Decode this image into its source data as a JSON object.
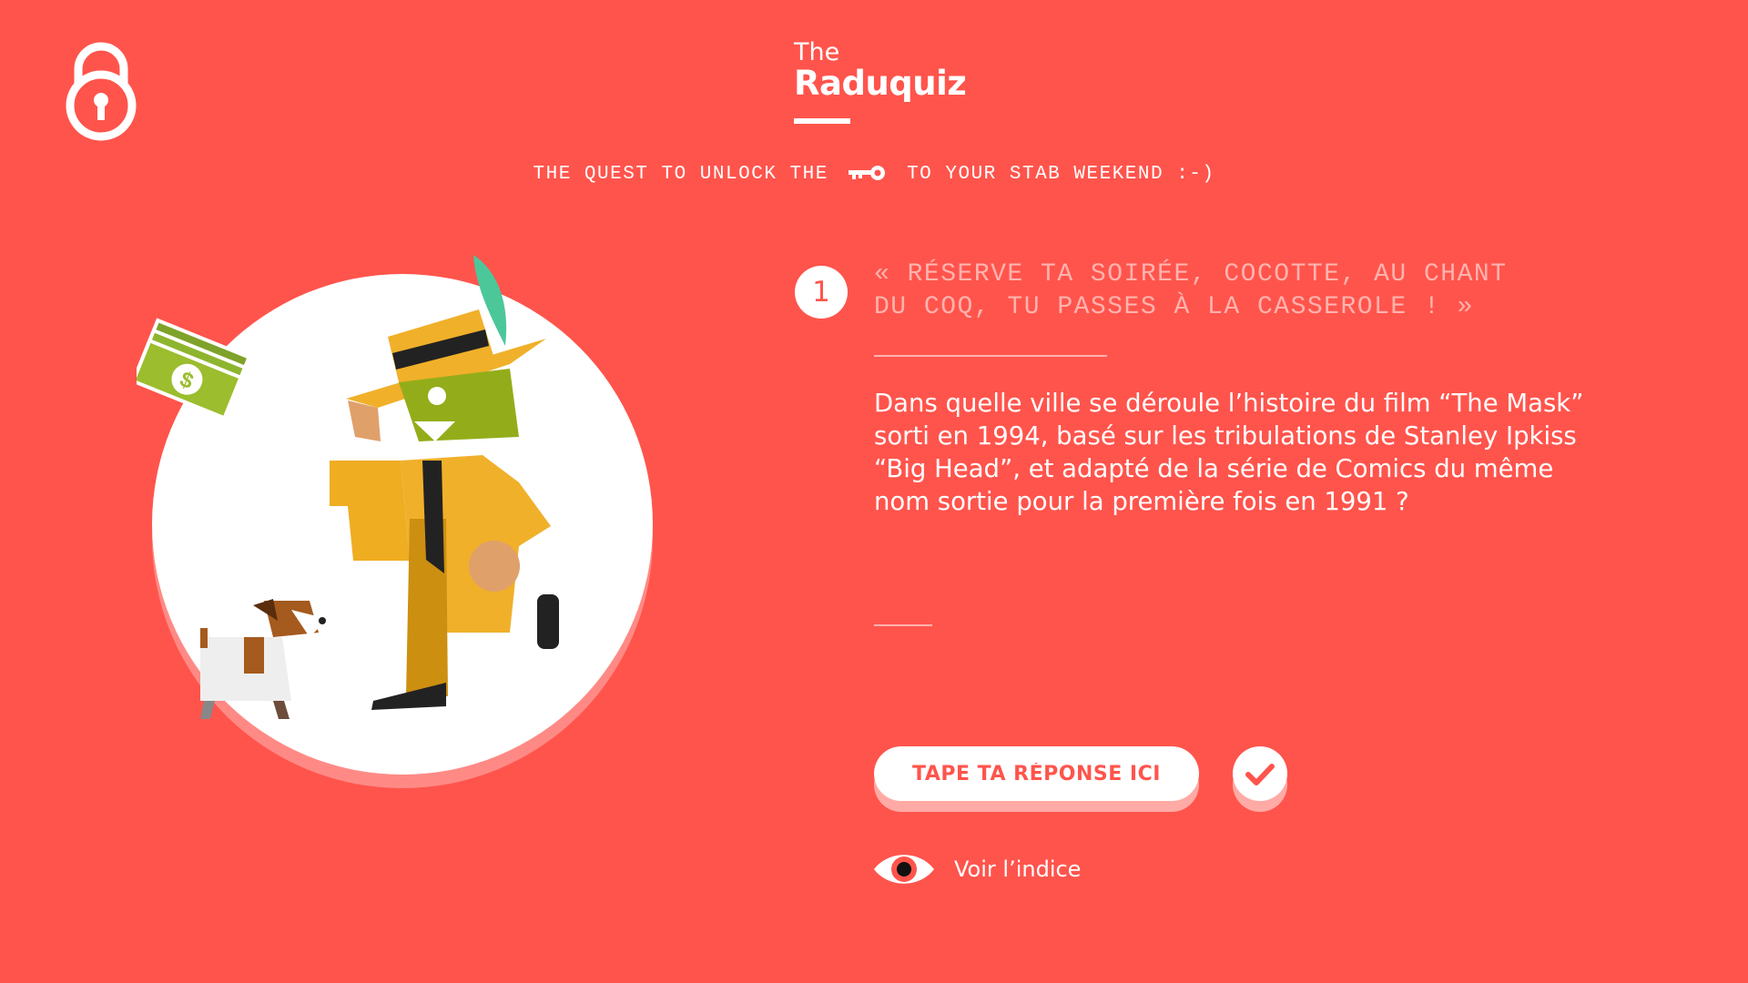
{
  "header": {
    "logo_small": "The",
    "logo_name": "Raduquiz",
    "tagline_before": "THE QUEST TO UNLOCK THE",
    "tagline_after": "TO YOUR STAB WEEKEND :-)",
    "lock_icon": "padlock-icon",
    "key_icon": "key-icon"
  },
  "question": {
    "number": "1",
    "quote": "« RÉSERVE TA SOIRÉE, COCOTTE, AU CHANT DU COQ, TU PASSES À LA CASSEROLE ! »",
    "text": "Dans quelle ville se déroule l’histoire du film “The Mask” sorti en 1994, basé sur les tribulations de Stanley Ipkiss “Big Head”, et adapté de la série de Comics du même nom sortie pour la première fois en 1991 ?"
  },
  "answer": {
    "placeholder": "TAPE TA RÉPONSE ICI",
    "submit_icon": "check-icon"
  },
  "hint": {
    "label": "Voir l’indice",
    "icon": "eye-icon"
  },
  "colors": {
    "background": "#ff544c",
    "accent_light": "#ffb3ae",
    "white": "#ffffff"
  }
}
